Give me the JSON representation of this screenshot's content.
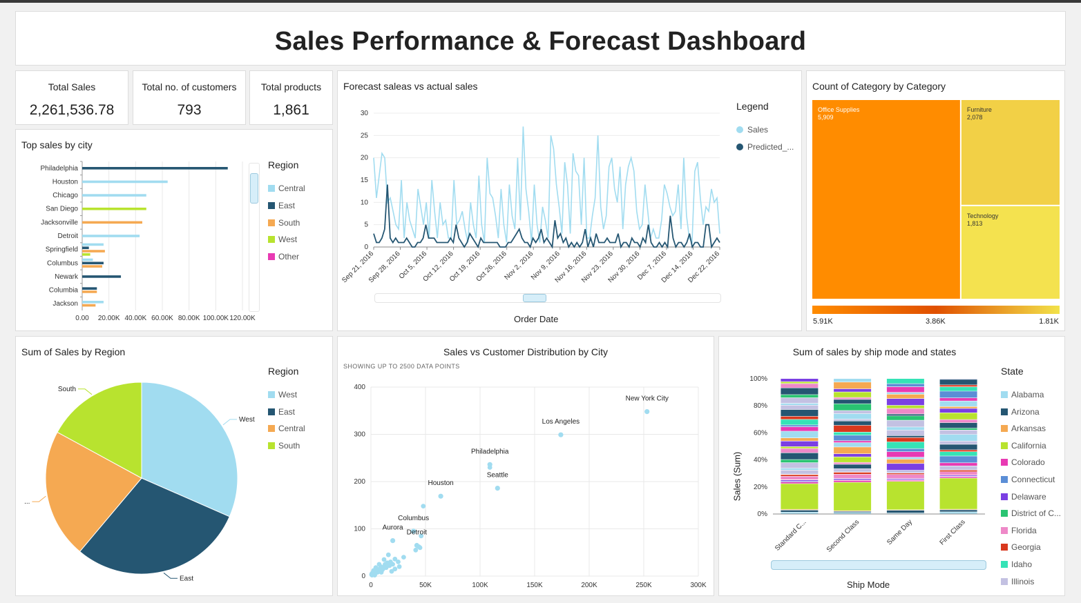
{
  "dashboard": {
    "title": "Sales Performance & Forecast Dashboard"
  },
  "kpis": [
    {
      "label": "Total Sales",
      "value": "2,261,536.78"
    },
    {
      "label": "Total no. of customers",
      "value": "793"
    },
    {
      "label": "Total products",
      "value": "1,861"
    }
  ],
  "colors": {
    "central": "#a1dcf0",
    "east": "#255672",
    "south": "#f5a952",
    "west": "#b8e32f",
    "other": "#e83ab3",
    "predicted": "#255672",
    "sales": "#a1dcf0"
  },
  "top_city": {
    "title": "Top sales by city",
    "legend_title": "Region",
    "legend": [
      "Central",
      "East",
      "South",
      "West",
      "Other"
    ]
  },
  "forecast": {
    "title": "Forecast saleas vs actual sales",
    "legend_title": "Legend",
    "legend": [
      "Sales",
      "Predicted_..."
    ],
    "xlabel": "Order Date"
  },
  "treemap": {
    "title": "Count of Category by Category",
    "scale_labels": [
      "5.91K",
      "3.86K",
      "1.81K"
    ]
  },
  "pie": {
    "title": "Sum of Sales by Region",
    "legend_title": "Region",
    "legend": [
      "West",
      "East",
      "Central",
      "South"
    ]
  },
  "scatter": {
    "title": "Sales vs Customer Distribution by City",
    "subtitle": "SHOWING UP TO 2500 DATA POINTS"
  },
  "stacked": {
    "title": "Sum of sales by ship mode and states",
    "legend_title": "State",
    "xlabel": "Ship Mode",
    "ylabel": "Sales (Sum)"
  },
  "chart_data": [
    {
      "type": "bar",
      "orientation": "horizontal",
      "title": "Top sales by city",
      "categories": [
        "Philadelphia",
        "Houston",
        "Chicago",
        "San Diego",
        "Jacksonville",
        "Detroit",
        "Springfield",
        "Columbus",
        "Newark",
        "Columbia",
        "Jackson"
      ],
      "series": [
        {
          "name": "Central",
          "values": [
            0,
            64000,
            48000,
            0,
            0,
            43000,
            16000,
            8000,
            0,
            0,
            16000
          ]
        },
        {
          "name": "East",
          "values": [
            109000,
            0,
            0,
            0,
            0,
            0,
            5000,
            16000,
            29000,
            11000,
            0
          ]
        },
        {
          "name": "South",
          "values": [
            0,
            0,
            0,
            0,
            45000,
            0,
            17000,
            15000,
            0,
            11000,
            10000
          ]
        },
        {
          "name": "West",
          "values": [
            0,
            0,
            0,
            48000,
            0,
            0,
            6000,
            0,
            0,
            0,
            0
          ]
        }
      ],
      "xlim": [
        0,
        120000
      ],
      "xticks": [
        "0.00",
        "20.00K",
        "40.00K",
        "60.00K",
        "80.00K",
        "100.00K",
        "120.00K"
      ]
    },
    {
      "type": "line",
      "title": "Forecast saleas vs actual sales",
      "xlabel": "Order Date",
      "x_ticks": [
        "Sep 21, 2016",
        "Sep 28, 2016",
        "Oct 5, 2016",
        "Oct 12, 2016",
        "Oct 19, 2016",
        "Oct 26, 2016",
        "Nov 2, 2016",
        "Nov 9, 2016",
        "Nov 16, 2016",
        "Nov 23, 2016",
        "Nov 30, 2016",
        "Dec 7, 2016",
        "Dec 14, 2016",
        "Dec 22, 2016"
      ],
      "ylim": [
        0,
        30
      ],
      "yticks": [
        0,
        5,
        10,
        15,
        20,
        25,
        30
      ],
      "series": [
        {
          "name": "Sales",
          "values": [
            20,
            11,
            16,
            21,
            20,
            10,
            11,
            8,
            5,
            4,
            15,
            2,
            10,
            6,
            4,
            2,
            13,
            9,
            5,
            10,
            2,
            15,
            8,
            2,
            10,
            5,
            6,
            2,
            2,
            15,
            5,
            6,
            8,
            4,
            1,
            10,
            5,
            2,
            16,
            5,
            1,
            20,
            12,
            11,
            7,
            2,
            13,
            5,
            1,
            14,
            7,
            4,
            20,
            6,
            27,
            13,
            8,
            1,
            14,
            5,
            1,
            9,
            6,
            2,
            25,
            22,
            14,
            9,
            3,
            19,
            14,
            3,
            21,
            17,
            16,
            5,
            20,
            2,
            2,
            7,
            11,
            25,
            9,
            4,
            7,
            18,
            20,
            13,
            10,
            18,
            4,
            14,
            18,
            20,
            17,
            8,
            4,
            5,
            14,
            8,
            2,
            4,
            2,
            2,
            6,
            14,
            12,
            9,
            7,
            8,
            14,
            4,
            20,
            7,
            2,
            1,
            17,
            19,
            11,
            5,
            9,
            8,
            13,
            10,
            11,
            3
          ]
        },
        {
          "name": "Predicted_...",
          "values": [
            3,
            1,
            1,
            2,
            4,
            14,
            2,
            1,
            2,
            1,
            1,
            1,
            2,
            1,
            0,
            0,
            1,
            1,
            2,
            5,
            2,
            2,
            2,
            1,
            1,
            1,
            1,
            1,
            2,
            1,
            5,
            2,
            1,
            0,
            1,
            3,
            2,
            1,
            0,
            2,
            1,
            1,
            1,
            1,
            1,
            1,
            0,
            0,
            0,
            1,
            1,
            2,
            3,
            4,
            2,
            1,
            1,
            0,
            2,
            1,
            2,
            4,
            1,
            2,
            1,
            0,
            6,
            2,
            3,
            1,
            2,
            0,
            1,
            0,
            1,
            0,
            1,
            4,
            0,
            2,
            0,
            3,
            1,
            1,
            1,
            2,
            1,
            1,
            1,
            3,
            0,
            1,
            1,
            0,
            2,
            1,
            1,
            0,
            2,
            1,
            5,
            1,
            0,
            0,
            1,
            0,
            1,
            0,
            7,
            2,
            0,
            1,
            1,
            0,
            1,
            3,
            0,
            1,
            1,
            0,
            0,
            5,
            5,
            0,
            1,
            2,
            1
          ]
        }
      ]
    },
    {
      "type": "treemap",
      "title": "Count of Category by Category",
      "items": [
        {
          "label": "Office Supplies",
          "value": 5909,
          "display": "5,909"
        },
        {
          "label": "Furniture",
          "value": 2078,
          "display": "2,078"
        },
        {
          "label": "Technology",
          "value": 1813,
          "display": "1,813"
        }
      ]
    },
    {
      "type": "pie",
      "title": "Sum of Sales by Region",
      "slices": [
        {
          "name": "West",
          "value": 725458
        },
        {
          "name": "East",
          "value": 678781
        },
        {
          "name": "Central",
          "value": 501240
        },
        {
          "name": "South",
          "value": 391722
        }
      ],
      "slice_labels": [
        "West",
        "East",
        "...",
        "South"
      ]
    },
    {
      "type": "scatter",
      "title": "Sales vs Customer Distribution by City",
      "xlim": [
        0,
        300000
      ],
      "ylim": [
        0,
        400
      ],
      "xticks": [
        "0",
        "50K",
        "100K",
        "150K",
        "200K",
        "250K",
        "300K"
      ],
      "yticks": [
        "0",
        "100",
        "200",
        "300",
        "400"
      ],
      "labeled_points": [
        {
          "label": "New York City",
          "x": 253000,
          "y": 348
        },
        {
          "label": "Los Angeles",
          "x": 174000,
          "y": 299
        },
        {
          "label": "Philadelphia",
          "x": 109000,
          "y": 236
        },
        {
          "label": "Seattle",
          "x": 116000,
          "y": 186
        },
        {
          "label": "Houston",
          "x": 64000,
          "y": 169
        },
        {
          "label": "Columbus",
          "x": 39000,
          "y": 95
        },
        {
          "label": "Detroit",
          "x": 42000,
          "y": 65
        },
        {
          "label": "Aurora",
          "x": 20000,
          "y": 75
        }
      ],
      "points": [
        [
          109000,
          230
        ],
        [
          48000,
          148
        ],
        [
          46000,
          85
        ],
        [
          44000,
          62
        ],
        [
          41000,
          55
        ],
        [
          45000,
          60
        ],
        [
          30000,
          40
        ],
        [
          25000,
          30
        ],
        [
          22000,
          36
        ],
        [
          20000,
          25
        ],
        [
          18000,
          30
        ],
        [
          17000,
          22
        ],
        [
          15000,
          28
        ],
        [
          14000,
          18
        ],
        [
          13000,
          25
        ],
        [
          12000,
          20
        ],
        [
          11000,
          15
        ],
        [
          10000,
          12
        ],
        [
          9000,
          20
        ],
        [
          8000,
          15
        ],
        [
          7000,
          10
        ],
        [
          6000,
          8
        ],
        [
          5000,
          14
        ],
        [
          4000,
          6
        ],
        [
          3000,
          10
        ],
        [
          2000,
          4
        ],
        [
          1500,
          7
        ],
        [
          1000,
          2
        ],
        [
          800,
          5
        ],
        [
          600,
          3
        ],
        [
          12000,
          35
        ],
        [
          16000,
          45
        ],
        [
          26000,
          20
        ],
        [
          22000,
          15
        ],
        [
          19000,
          10
        ],
        [
          7500,
          25
        ],
        [
          4500,
          18
        ],
        [
          3500,
          2
        ],
        [
          2500,
          12
        ],
        [
          9500,
          8
        ]
      ]
    },
    {
      "type": "bar",
      "stacked": "percent",
      "title": "Sum of sales by ship mode and states",
      "categories": [
        "Standard C...",
        "Second Class",
        "Same Day",
        "First Class"
      ],
      "ylabel": "Sales (Sum)",
      "xlabel": "Ship Mode",
      "yticks": [
        "0%",
        "20%",
        "40%",
        "60%",
        "80%",
        "100%"
      ],
      "series": [
        {
          "name": "Alabama",
          "color": "#a1dcf0",
          "values": [
            1.2,
            1.0,
            0.6,
            1.4
          ]
        },
        {
          "name": "Arizona",
          "color": "#255672",
          "values": [
            1.5,
            0.8,
            2.0,
            1.5
          ]
        },
        {
          "name": "Arkansas",
          "color": "#f5a952",
          "values": [
            0.6,
            0.5,
            0.4,
            0.5
          ]
        },
        {
          "name": "California",
          "color": "#b8e32f",
          "values": [
            19.0,
            21.0,
            21.0,
            23.0
          ]
        },
        {
          "name": "Colorado",
          "color": "#e83ab3",
          "values": [
            1.2,
            1.4,
            0.8,
            1.0
          ]
        },
        {
          "name": "Connecticut",
          "color": "#5b8ed6",
          "values": [
            0.5,
            0.4,
            0.3,
            0.3
          ]
        },
        {
          "name": "Delaware",
          "color": "#7b3fe3",
          "values": [
            1.0,
            0.9,
            0.8,
            0.8
          ]
        },
        {
          "name": "District of C...",
          "color": "#2ac472",
          "values": [
            0.2,
            0.2,
            0.2,
            0.1
          ]
        },
        {
          "name": "Florida",
          "color": "#ee89c8",
          "values": [
            2.5,
            3.0,
            3.0,
            2.5
          ]
        },
        {
          "name": "Georgia",
          "color": "#d9381e",
          "values": [
            1.3,
            1.5,
            1.0,
            1.2
          ]
        },
        {
          "name": "Idaho",
          "color": "#35e3b6",
          "values": [
            0.3,
            0.2,
            0.1,
            0.1
          ]
        },
        {
          "name": "Illinois",
          "color": "#c3c1e2",
          "values": [
            3.0,
            2.5,
            2.0,
            3.0
          ]
        }
      ]
    }
  ]
}
